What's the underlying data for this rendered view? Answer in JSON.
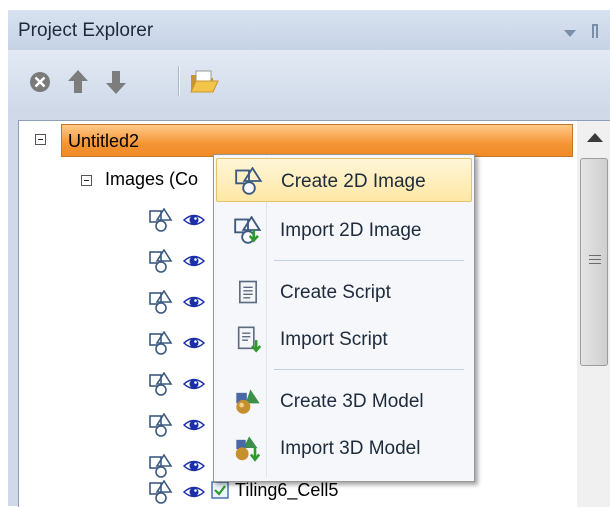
{
  "panel": {
    "title": "Project Explorer",
    "icons": [
      "dropdown-arrow-icon",
      "pin-icon"
    ]
  },
  "toolbar": {
    "buttons": [
      {
        "name": "delete",
        "icon": "close-circle-icon"
      },
      {
        "name": "move-up",
        "icon": "arrow-up-icon"
      },
      {
        "name": "move-down",
        "icon": "arrow-down-icon"
      },
      {
        "name": "open",
        "icon": "folder-open-icon"
      }
    ]
  },
  "tree": {
    "root": {
      "label": "Untitled2",
      "expanded": true
    },
    "images_group": {
      "label": "Images (Co",
      "expanded": true
    },
    "image_rows": 7,
    "partial_row": {
      "label": "Tiling6_Cell5"
    }
  },
  "context_menu": {
    "items": [
      {
        "label": "Create 2D Image",
        "icon": "create-2d-image-icon",
        "highlighted": true
      },
      {
        "label": "Import 2D Image",
        "icon": "import-2d-image-icon",
        "highlighted": false
      },
      {
        "label": "Create Script",
        "icon": "script-icon",
        "highlighted": false
      },
      {
        "label": "Import Script",
        "icon": "import-script-icon",
        "highlighted": false
      },
      {
        "label": "Create 3D Model",
        "icon": "create-3d-model-icon",
        "highlighted": false
      },
      {
        "label": "Import 3D Model",
        "icon": "import-3d-model-icon",
        "highlighted": false
      }
    ]
  },
  "colors": {
    "panel_bg": "#cfd9e8",
    "selection_orange": "#f59535",
    "menu_highlight": "#ffe7a5",
    "eye_blue": "#1b2fa8"
  }
}
